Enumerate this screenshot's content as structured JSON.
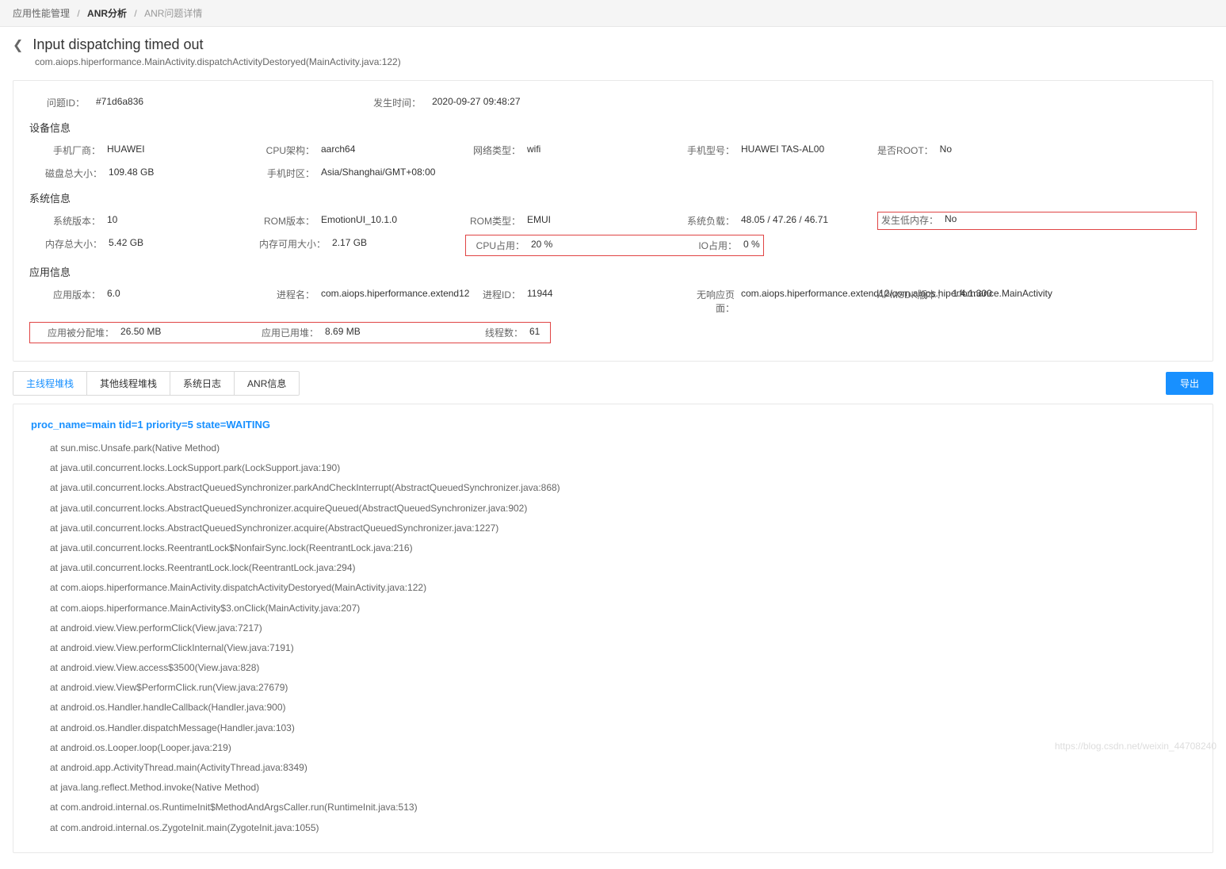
{
  "breadcrumb": {
    "l1": "应用性能管理",
    "l2": "ANR分析",
    "l3": "ANR问题详情"
  },
  "header": {
    "title": "Input dispatching timed out",
    "subtitle": "com.aiops.hiperformance.MainActivity.dispatchActivityDestoryed(MainActivity.java:122)"
  },
  "summary": {
    "issueIdLabel": "问题ID：",
    "issueId": "#71d6a836",
    "timeLabel": "发生时间：",
    "time": "2020-09-27 09:48:27"
  },
  "device": {
    "title": "设备信息",
    "vendorLabel": "手机厂商：",
    "vendor": "HUAWEI",
    "cpuArchLabel": "CPU架构：",
    "cpuArch": "aarch64",
    "netLabel": "网络类型：",
    "net": "wifi",
    "modelLabel": "手机型号：",
    "model": "HUAWEI TAS-AL00",
    "rootLabel": "是否ROOT：",
    "root": "No",
    "diskLabel": "磁盘总大小：",
    "disk": "109.48 GB",
    "tzLabel": "手机时区：",
    "tz": "Asia/Shanghai/GMT+08:00"
  },
  "system": {
    "title": "系统信息",
    "osVerLabel": "系统版本：",
    "osVer": "10",
    "romVerLabel": "ROM版本：",
    "romVer": "EmotionUI_10.1.0",
    "romTypeLabel": "ROM类型：",
    "romType": "EMUI",
    "loadLabel": "系统负载：",
    "load": "48.05 / 47.26 / 46.71",
    "lowMemLabel": "发生低内存：",
    "lowMem": "No",
    "memTotalLabel": "内存总大小：",
    "memTotal": "5.42 GB",
    "memAvailLabel": "内存可用大小：",
    "memAvail": "2.17 GB",
    "cpuLabel": "CPU占用：",
    "cpu": "20 %",
    "ioLabel": "IO占用：",
    "io": "0 %"
  },
  "app": {
    "title": "应用信息",
    "verLabel": "应用版本：",
    "ver": "6.0",
    "procNameLabel": "进程名：",
    "procName": "com.aiops.hiperformance.extend12",
    "pidLabel": "进程ID：",
    "pid": "11944",
    "anrPageLabel": "无响应页面：",
    "anrPage": "com.aiops.hiperformance.extend12/com.aiops.hiperformance.MainActivity",
    "sdkVerLabel": "APMSDK版本：",
    "sdkVer": "1.4.1.300",
    "heapAllocLabel": "应用被分配堆：",
    "heapAlloc": "26.50 MB",
    "heapUsedLabel": "应用已用堆：",
    "heapUsed": "8.69 MB",
    "threadsLabel": "线程数：",
    "threads": "61"
  },
  "tabs": {
    "t1": "主线程堆栈",
    "t2": "其他线程堆栈",
    "t3": "系统日志",
    "t4": "ANR信息",
    "export": "导出"
  },
  "stack": {
    "title": "proc_name=main tid=1 priority=5 state=WAITING",
    "lines": [
      "at sun.misc.Unsafe.park(Native Method)",
      "at java.util.concurrent.locks.LockSupport.park(LockSupport.java:190)",
      "at java.util.concurrent.locks.AbstractQueuedSynchronizer.parkAndCheckInterrupt(AbstractQueuedSynchronizer.java:868)",
      "at java.util.concurrent.locks.AbstractQueuedSynchronizer.acquireQueued(AbstractQueuedSynchronizer.java:902)",
      "at java.util.concurrent.locks.AbstractQueuedSynchronizer.acquire(AbstractQueuedSynchronizer.java:1227)",
      "at java.util.concurrent.locks.ReentrantLock$NonfairSync.lock(ReentrantLock.java:216)",
      "at java.util.concurrent.locks.ReentrantLock.lock(ReentrantLock.java:294)",
      "at com.aiops.hiperformance.MainActivity.dispatchActivityDestoryed(MainActivity.java:122)",
      "at com.aiops.hiperformance.MainActivity$3.onClick(MainActivity.java:207)",
      "at android.view.View.performClick(View.java:7217)",
      "at android.view.View.performClickInternal(View.java:7191)",
      "at android.view.View.access$3500(View.java:828)",
      "at android.view.View$PerformClick.run(View.java:27679)",
      "at android.os.Handler.handleCallback(Handler.java:900)",
      "at android.os.Handler.dispatchMessage(Handler.java:103)",
      "at android.os.Looper.loop(Looper.java:219)",
      "at android.app.ActivityThread.main(ActivityThread.java:8349)",
      "at java.lang.reflect.Method.invoke(Native Method)",
      "at com.android.internal.os.RuntimeInit$MethodAndArgsCaller.run(RuntimeInit.java:513)",
      "at com.android.internal.os.ZygoteInit.main(ZygoteInit.java:1055)"
    ]
  },
  "watermark": "https://blog.csdn.net/weixin_44708240"
}
